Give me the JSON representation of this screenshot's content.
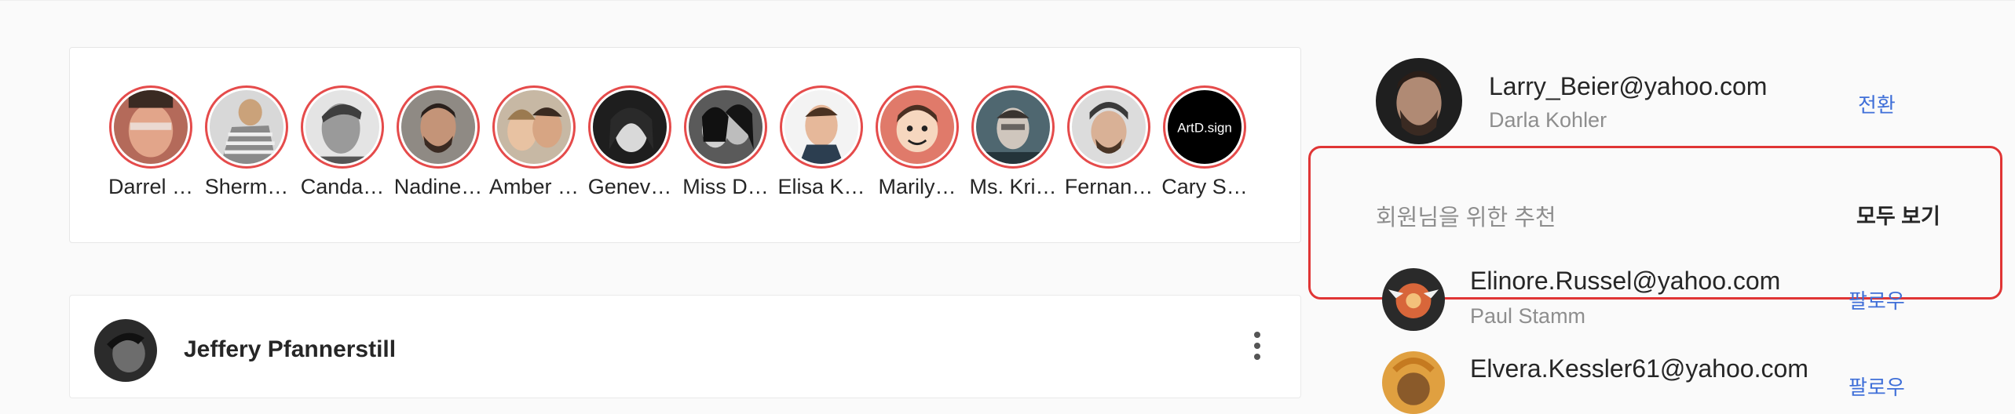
{
  "stories": [
    {
      "name": "Darrel …"
    },
    {
      "name": "Sherm…"
    },
    {
      "name": "Canda…"
    },
    {
      "name": "Nadine…"
    },
    {
      "name": "Amber …"
    },
    {
      "name": "Genev…"
    },
    {
      "name": "Miss D…"
    },
    {
      "name": "Elisa K…"
    },
    {
      "name": "Marily…"
    },
    {
      "name": "Ms. Kri…"
    },
    {
      "name": "Fernan…"
    },
    {
      "name": "Cary S…",
      "avatar_text": "ArtD.sign"
    }
  ],
  "post": {
    "author": "Jeffery Pfannerstill"
  },
  "sidebar": {
    "current_user": {
      "username": "Larry_Beier@yahoo.com",
      "full_name": "Darla Kohler",
      "switch_label": "전환"
    },
    "suggestions": {
      "title": "회원님을 위한 추천",
      "see_all_label": "모두 보기",
      "items": [
        {
          "username": "Elinore.Russel@yahoo.com",
          "full_name": "Paul Stamm",
          "follow_label": "팔로우"
        },
        {
          "username": "Elvera.Kessler61@yahoo.com",
          "full_name": "",
          "follow_label": "팔로우"
        }
      ]
    }
  },
  "colors": {
    "story_ring": "#e54b4b",
    "highlight": "#e03535",
    "link": "#3f6fd8"
  }
}
